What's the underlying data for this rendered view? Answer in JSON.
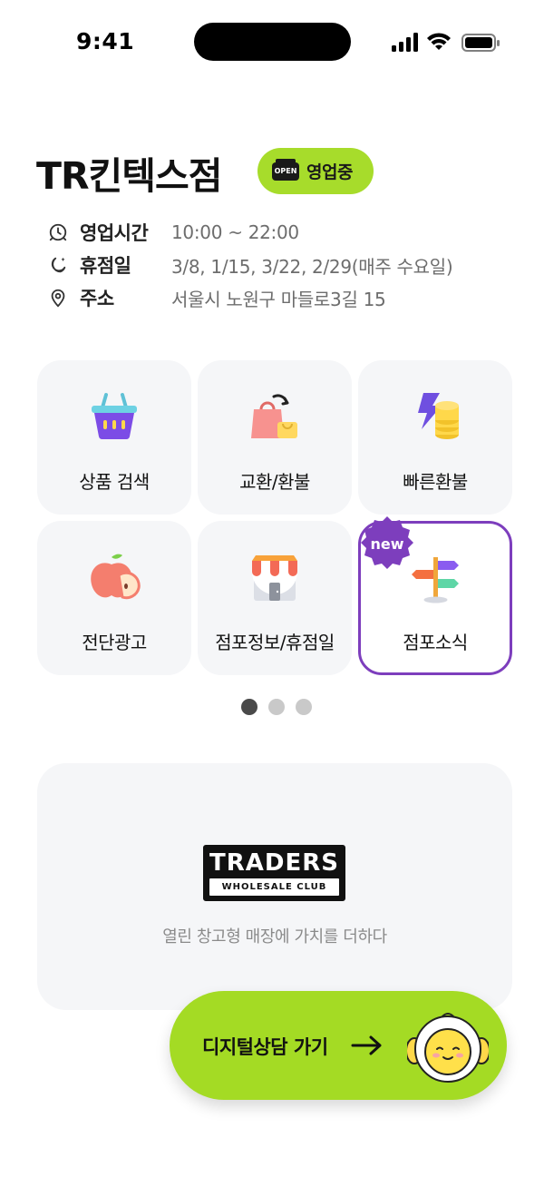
{
  "status_bar": {
    "time": "9:41"
  },
  "store": {
    "name": "TR킨텍스점",
    "open_badge": {
      "icon_text": "OPEN",
      "label": "영업중"
    },
    "info": [
      {
        "icon": "clock-icon",
        "label": "영업시간",
        "value": "10:00 ~ 22:00"
      },
      {
        "icon": "moon-icon",
        "label": "휴점일",
        "value": "3/8, 1/15, 3/22, 2/29(매주 수요일)"
      },
      {
        "icon": "location-pin-icon",
        "label": "주소",
        "value": "서울시 노원구 마들로3길 15"
      }
    ]
  },
  "menu": {
    "items": [
      {
        "icon": "shopping-basket-icon",
        "label": "상품 검색"
      },
      {
        "icon": "shopping-bag-exchange-icon",
        "label": "교환/환불"
      },
      {
        "icon": "lightning-coins-icon",
        "label": "빠른환불"
      },
      {
        "icon": "apple-icon",
        "label": "전단광고"
      },
      {
        "icon": "storefront-icon",
        "label": "점포정보/휴점일"
      },
      {
        "icon": "signpost-icon",
        "label": "점포소식",
        "badge": "new",
        "highlighted": true
      }
    ]
  },
  "pager": {
    "pages": 3,
    "active": 1
  },
  "banner": {
    "logo_main": "TRADERS",
    "logo_sub": "WHOLESALE CLUB",
    "tagline": "열린 창고형 매장에 가치를 더하다"
  },
  "cta": {
    "label": "디지털상담 가기",
    "icon": "arrow-right-icon",
    "mascot": "mascot-icon"
  },
  "colors": {
    "accent_green": "#a7dc2b",
    "highlight_purple": "#7d3ebd",
    "tile_bg": "#f5f6f8"
  }
}
